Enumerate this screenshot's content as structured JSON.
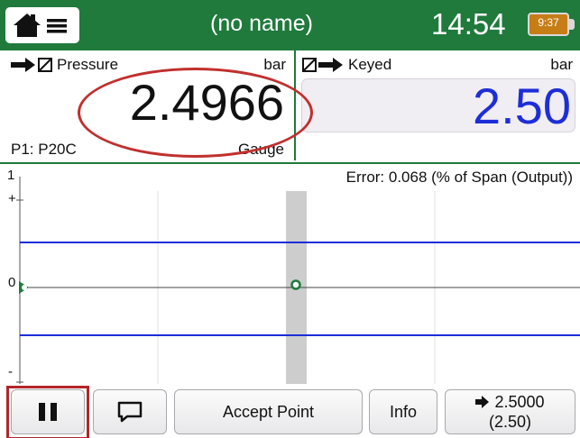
{
  "header": {
    "title": "(no name)",
    "clock": "14:54",
    "battery_time": "9:37",
    "home_icon": "home-icon",
    "menu_icon": "menu-icon",
    "background_color": "#1f7a3c",
    "battery_color": "#c77d16"
  },
  "left_panel": {
    "function_label": "Pressure",
    "function_icon": "measure-arrow-icon",
    "unit": "bar",
    "value": "2.4966",
    "module": "P1: P20C",
    "pressure_type": "Gauge"
  },
  "right_panel": {
    "function_label": "Keyed",
    "function_icon": "keyed-arrow-icon",
    "unit": "bar",
    "value": "2.50",
    "value_color": "#1d2ed8"
  },
  "graph": {
    "error_text": "Error: 0.068 (% of Span (Output))",
    "y_axis_top": "1",
    "y_axis_plus": "+",
    "y_axis_zero": "0",
    "y_axis_minus": "-",
    "limit_line_color": "#1d2ed8"
  },
  "toolbar": {
    "pause_icon": "pause-icon",
    "comment_icon": "comment-icon",
    "accept_label": "Accept Point",
    "info_label": "Info",
    "send_value": "2.5000",
    "send_sub": "(2.50)",
    "send_icon": "arrow-right-icon"
  }
}
